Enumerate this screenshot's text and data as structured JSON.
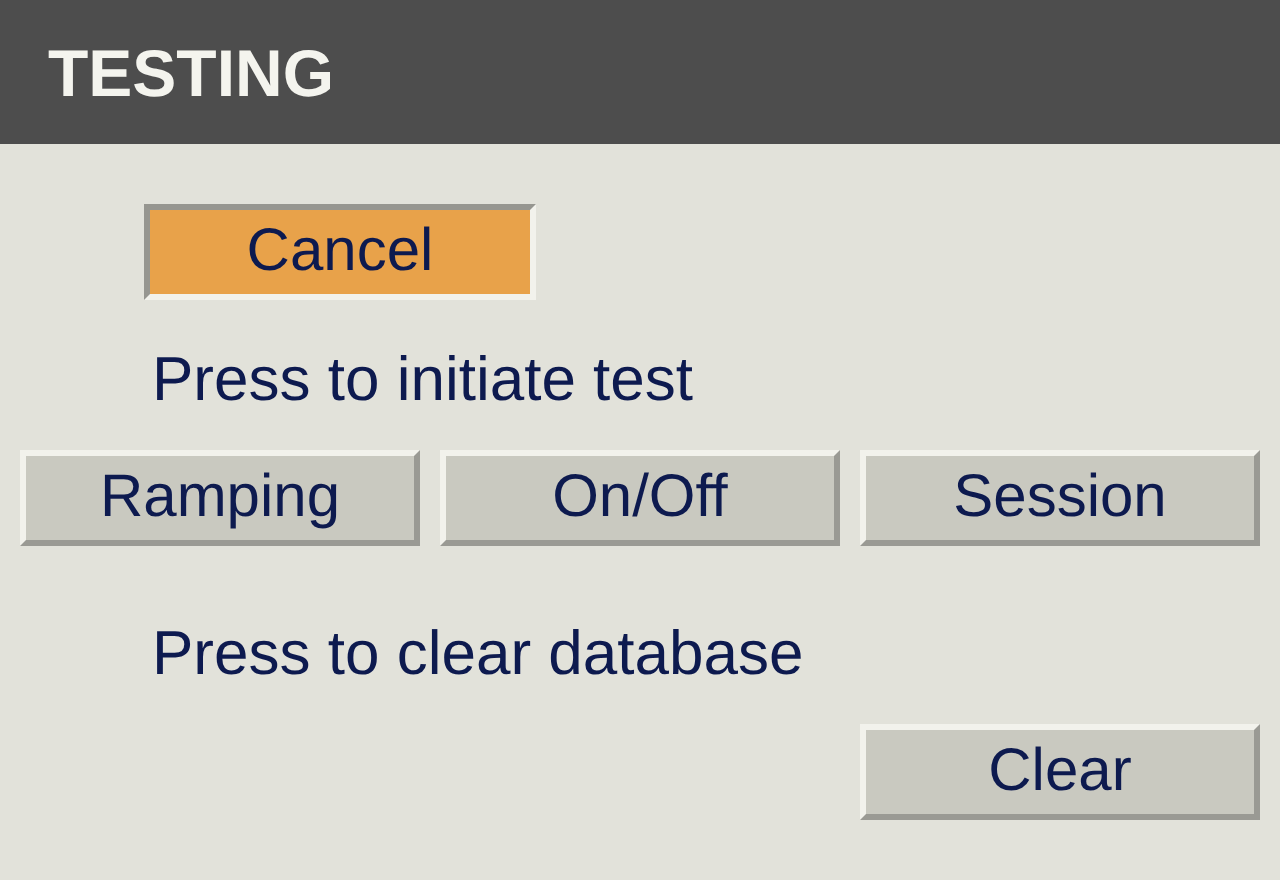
{
  "title": "TESTING",
  "cancel_button": {
    "label": "Cancel",
    "highlighted": true
  },
  "test": {
    "prompt": "Press to initiate test",
    "buttons": [
      {
        "label": "Ramping"
      },
      {
        "label": "On/Off"
      },
      {
        "label": "Session"
      }
    ]
  },
  "clear": {
    "prompt": "Press to clear database",
    "button": {
      "label": "Clear"
    }
  }
}
